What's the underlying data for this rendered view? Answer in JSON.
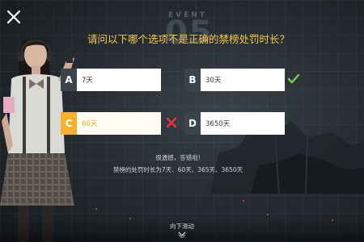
{
  "background": {
    "event_label": "EVENT",
    "event_number": "05"
  },
  "question": {
    "text": "请问以下哪个选项不是正确的禁榜处罚时长？"
  },
  "options": [
    {
      "letter": "A",
      "text": "7天",
      "state": "normal"
    },
    {
      "letter": "B",
      "text": "30天",
      "state": "correct"
    },
    {
      "letter": "C",
      "text": "60天",
      "state": "wrong"
    },
    {
      "letter": "D",
      "text": "3650天",
      "state": "normal"
    }
  ],
  "feedback": {
    "line1": "很遗憾，答错啦!",
    "line2": "禁榜的处罚时长为7天、60天、365天、3650天"
  },
  "footer": {
    "scroll_hint": "向下滑动"
  },
  "colors": {
    "question_text": "#f2c94c",
    "correct_mark": "#7cd14f",
    "wrong_mark": "#e23a3a",
    "wrong_accent": "#f6b02e",
    "letter_box": "#3d434a"
  },
  "icons": {
    "close": "close-icon",
    "correct": "check-icon",
    "wrong": "cross-icon",
    "scroll": "chevron-down-icon"
  }
}
